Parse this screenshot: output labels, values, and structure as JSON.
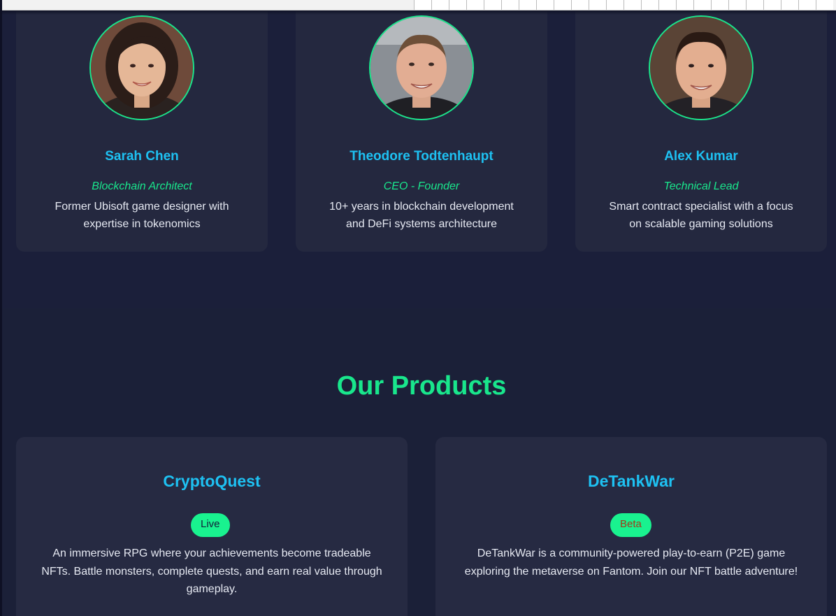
{
  "team": {
    "members": [
      {
        "name": "Sarah Chen",
        "role": "Blockchain Architect",
        "description": "Former Ubisoft game designer with expertise in tokenomics"
      },
      {
        "name": "Theodore Todtenhaupt",
        "role": "CEO - Founder",
        "description": "10+ years in blockchain development and DeFi systems architecture"
      },
      {
        "name": "Alex Kumar",
        "role": "Technical Lead",
        "description": "Smart contract specialist with a focus on scalable gaming solutions"
      }
    ]
  },
  "products": {
    "title": "Our Products",
    "items": [
      {
        "name": "CryptoQuest",
        "status": "Live",
        "description": "An immersive RPG where your achievements become tradeable NFTs. Battle monsters, complete quests, and earn real value through gameplay."
      },
      {
        "name": "DeTankWar",
        "status": "Beta",
        "description": "DeTankWar is a community-powered play-to-earn (P2E) game exploring the metaverse on Fantom. Join our NFT battle adventure!"
      }
    ]
  },
  "colors": {
    "background": "#1b1f3a",
    "card": "#24283f",
    "accent_green": "#19e68c",
    "accent_blue": "#1ec1f2",
    "beta_text": "#a13a1a"
  }
}
